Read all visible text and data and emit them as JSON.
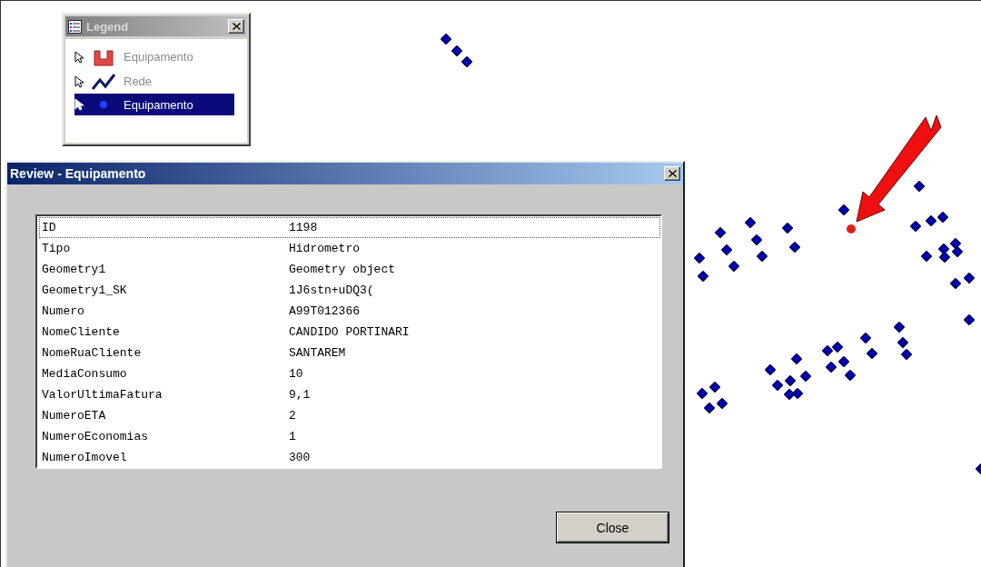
{
  "legend": {
    "title": "Legend",
    "items": [
      {
        "label": "Equipamento",
        "kind": "polygon",
        "selected": false
      },
      {
        "label": "Rede",
        "kind": "line",
        "selected": false
      },
      {
        "label": "Equipamento",
        "kind": "point",
        "selected": true
      }
    ]
  },
  "dialog": {
    "title": "Review - Equipamento",
    "rows": [
      {
        "field": "ID",
        "value": "1198",
        "focused": true
      },
      {
        "field": "Tipo",
        "value": "Hidrometro",
        "focused": false
      },
      {
        "field": "Geometry1",
        "value": "Geometry object",
        "focused": false
      },
      {
        "field": "Geometry1_SK",
        "value": "1J6stn+uDQ3(",
        "focused": false
      },
      {
        "field": "Numero",
        "value": "A99T012366",
        "focused": false
      },
      {
        "field": "NomeCliente",
        "value": "CANDIDO PORTINARI",
        "focused": false
      },
      {
        "field": "NomeRuaCliente",
        "value": "SANTAREM",
        "focused": false
      },
      {
        "field": "MediaConsumo",
        "value": "10",
        "focused": false
      },
      {
        "field": "ValorUltimaFatura",
        "value": "9,1",
        "focused": false
      },
      {
        "field": "NumeroETA",
        "value": "2",
        "focused": false
      },
      {
        "field": "NumeroEconomias",
        "value": "1",
        "focused": false
      },
      {
        "field": "NumeroImovel",
        "value": "300",
        "focused": false
      }
    ],
    "buttons": [
      "Close"
    ]
  }
}
